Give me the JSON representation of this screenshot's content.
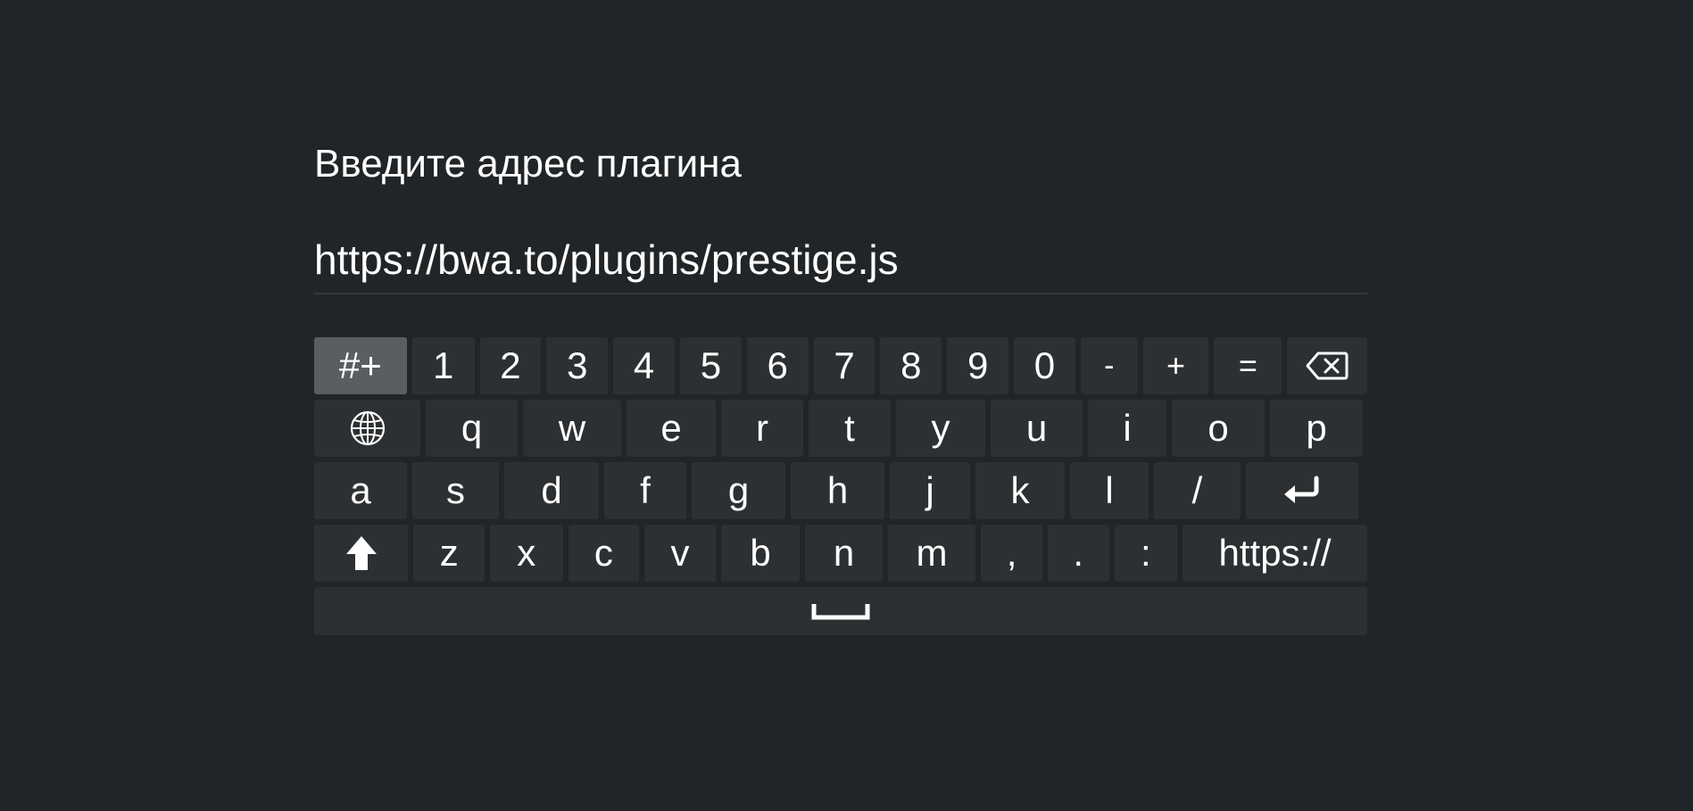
{
  "dialog": {
    "title": "Введите адрес плагина",
    "input_value": "https://bwa.to/plugins/prestige.js"
  },
  "keyboard": {
    "row1": [
      "#+",
      "1",
      "2",
      "3",
      "4",
      "5",
      "6",
      "7",
      "8",
      "9",
      "0",
      "-",
      "+",
      "="
    ],
    "row1_end_icon": "backspace-icon",
    "row2_start_icon": "globe-icon",
    "row2": [
      "q",
      "w",
      "e",
      "r",
      "t",
      "y",
      "u",
      "i",
      "o",
      "p"
    ],
    "row3": [
      "a",
      "s",
      "d",
      "f",
      "g",
      "h",
      "j",
      "k",
      "l",
      "/"
    ],
    "row3_end_icon": "enter-icon",
    "row4_start_icon": "shift-icon",
    "row4": [
      "z",
      "x",
      "c",
      "v",
      "b",
      "n",
      "m",
      ",",
      ".",
      ":",
      "https://"
    ],
    "row5_icon": "space-icon",
    "focused_key": "#+"
  },
  "colors": {
    "background": "#222527",
    "key": "#2d3032",
    "key_focused": "#5a5e61",
    "text": "#ffffff"
  }
}
